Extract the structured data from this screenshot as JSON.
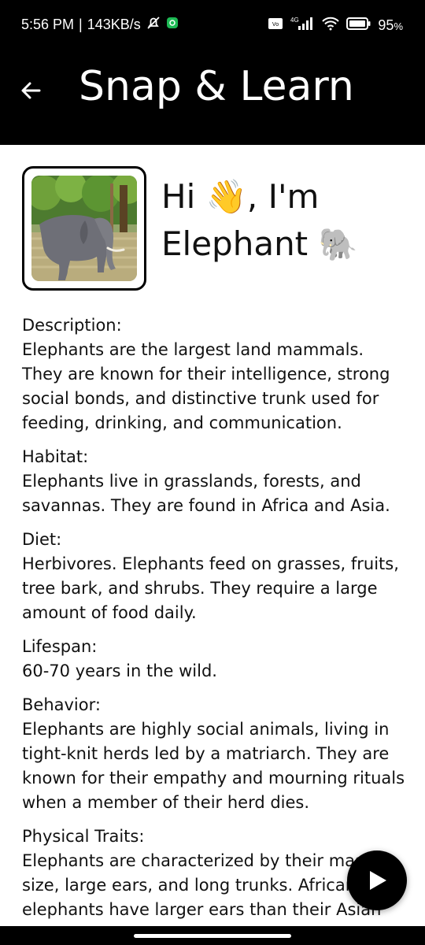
{
  "status_bar": {
    "time": "5:56 PM",
    "speed": "143KB/s",
    "network": "4G",
    "battery": "95"
  },
  "app_bar": {
    "title": "Snap & Learn"
  },
  "profile": {
    "greeting_line1": "Hi 👋, I'm",
    "animal_name": "Elephant",
    "animal_emoji": "🐘"
  },
  "sections": [
    {
      "label": "Description:",
      "text": "Elephants are the largest land mammals. They are known for their intelligence, strong social bonds, and distinctive trunk used for feeding, drinking, and communication."
    },
    {
      "label": "Habitat:",
      "text": "Elephants live in grasslands, forests, and savannas. They are found in Africa and Asia."
    },
    {
      "label": "Diet:",
      "text": "Herbivores. Elephants feed on grasses, fruits, tree bark, and shrubs. They require a large amount of food daily."
    },
    {
      "label": "Lifespan:",
      "text": "60-70 years in the wild."
    },
    {
      "label": "Behavior:",
      "text": "Elephants are highly social animals, living in tight-knit herds led by a matriarch. They are known for their empathy and mourning rituals when a member of their herd dies."
    },
    {
      "label": "Physical Traits:",
      "text": "Elephants are characterized by their massive size, large ears, and long trunks. African elephants have larger ears than their Asian"
    }
  ],
  "colors": {
    "app_bar": "#000000",
    "background": "#ffffff",
    "text": "#111111"
  },
  "icons": [
    "back-arrow-icon",
    "play-icon",
    "wifi-icon",
    "signal-icon",
    "battery-icon",
    "notification-muted-icon"
  ]
}
